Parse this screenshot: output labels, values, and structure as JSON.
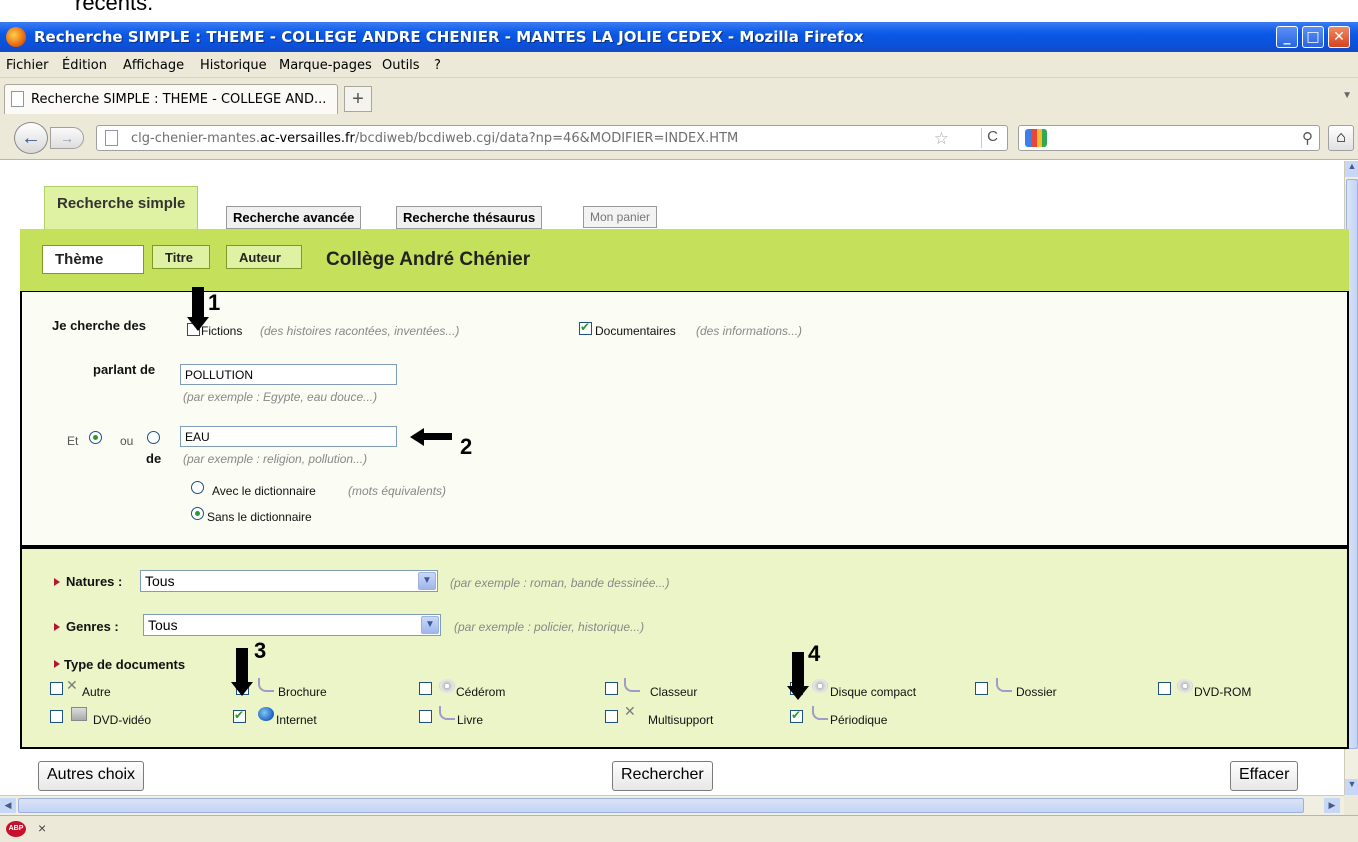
{
  "top_fragment": "récents.",
  "window": {
    "title": "Recherche SIMPLE : THEME - COLLEGE ANDRE CHENIER - MANTES LA JOLIE CEDEX - Mozilla Firefox",
    "minimize": "_",
    "maximize": "□",
    "close": "✕"
  },
  "menu": [
    "Fichier",
    "Édition",
    "Affichage",
    "Historique",
    "Marque-pages",
    "Outils",
    "?"
  ],
  "tab": {
    "label": "Recherche SIMPLE : THEME - COLLEGE AND...",
    "new_tab": "+"
  },
  "nav": {
    "url_prefix": "clg-chenier-mantes.",
    "url_domain": "ac-versailles.fr",
    "url_path": "/bcdiweb/bcdiweb.cgi/data?np=46&MODIFIER=INDEX.HTM",
    "back": "←",
    "forward": "→",
    "reload": "C",
    "home": "⌂",
    "search_icon": "magnifier-icon",
    "bookmark_star": "☆"
  },
  "search_tabs": {
    "simple": "Recherche simple",
    "advanced": "Recherche avancée",
    "thesaurus": "Recherche thésaurus",
    "cart": "Mon panier"
  },
  "criteria_tabs": {
    "theme": "Thème",
    "title": "Titre",
    "author": "Auteur"
  },
  "college_name": "Collège André Chénier",
  "form": {
    "je_cherche": "Je cherche des",
    "fictions_label": "Fictions",
    "fictions_hint": "(des histoires racontées, inventées...)",
    "fictions_checked": false,
    "docs_label": "Documentaires",
    "docs_hint": "(des informations...)",
    "docs_checked": true,
    "parlant_de": "parlant de",
    "term1": "POLLUTION",
    "term1_hint": "(par exemple : Egypte, eau douce...)",
    "et": "Et",
    "ou": "ou",
    "de": "de",
    "term2": "EAU",
    "term2_hint": "(par exemple : religion, pollution...)",
    "dict_with": "Avec le dictionnaire",
    "dict_with_hint": "(mots équivalents)",
    "dict_without": "Sans le dictionnaire",
    "natures_label": "Natures :",
    "natures_value": "Tous",
    "natures_hint": "(par exemple : roman, bande dessinée...)",
    "genres_label": "Genres :",
    "genres_value": "Tous",
    "genres_hint": "(par exemple : policier, historique...)",
    "type_label": "Type de documents",
    "types": [
      {
        "label": "Autre",
        "checked": false,
        "icon": "cross-icon"
      },
      {
        "label": "Brochure",
        "checked": false,
        "icon": "brochure-icon"
      },
      {
        "label": "Cédérom",
        "checked": false,
        "icon": "cd-icon"
      },
      {
        "label": "Classeur",
        "checked": false,
        "icon": "binder-icon"
      },
      {
        "label": "Disque compact",
        "checked": false,
        "icon": "cd-icon"
      },
      {
        "label": "Dossier",
        "checked": false,
        "icon": "folder-icon"
      },
      {
        "label": "DVD-ROM",
        "checked": false,
        "icon": "dvd-icon"
      },
      {
        "label": "DVD-vidéo",
        "checked": false,
        "icon": "film-icon"
      },
      {
        "label": "Internet",
        "checked": true,
        "icon": "globe-icon"
      },
      {
        "label": "Livre",
        "checked": false,
        "icon": "book-icon"
      },
      {
        "label": "Multisupport",
        "checked": false,
        "icon": "cross-icon"
      },
      {
        "label": "Périodique",
        "checked": true,
        "icon": "periodical-icon"
      }
    ]
  },
  "annotations": [
    "1",
    "2",
    "3",
    "4"
  ],
  "buttons": {
    "other": "Autres choix",
    "search": "Rechercher",
    "clear": "Effacer"
  },
  "status": {
    "abp": "ABP",
    "close": "×"
  }
}
